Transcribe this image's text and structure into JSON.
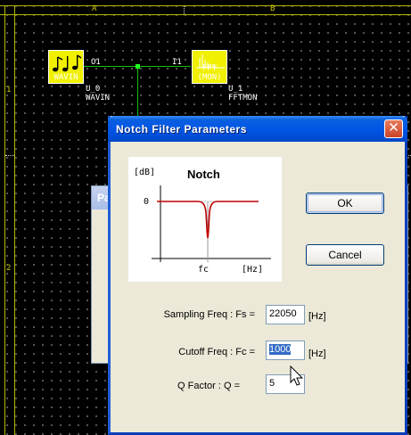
{
  "schematic": {
    "zones": {
      "col_a": "A",
      "col_b": "B",
      "row_1": "1",
      "row_2": "2"
    },
    "components": [
      {
        "icon": "music-notes-icon",
        "caption": "WAVIN",
        "port": "O1",
        "ref": "U_0",
        "type": "WAVIN"
      },
      {
        "icon": "spectrum-icon",
        "caption_line1": "FFT",
        "caption_line2": "(MON)",
        "port": "I1",
        "ref": "U_1",
        "type": "FFTMON"
      }
    ],
    "colors": {
      "grid_dot": "#6b6b6b",
      "frame": "#b8b800",
      "block": "#f0f000",
      "wire": "#10c010"
    }
  },
  "background_dialog": {
    "title_fragment": "Pa"
  },
  "dialog": {
    "title": "Notch Filter Parameters",
    "close_glyph": "✕",
    "graph": {
      "title": "Notch",
      "ylabel": "[dB]",
      "y_tick": "0",
      "x_tick": "fc",
      "xlabel": "[Hz]",
      "response_color": "#c00000"
    },
    "buttons": {
      "ok": "OK",
      "cancel": "Cancel"
    },
    "fields": {
      "fs": {
        "label": "Sampling Freq : Fs =",
        "value": "22050",
        "unit": "[Hz]"
      },
      "fc": {
        "label": "Cutoff Freq : Fc =",
        "value": "1000",
        "unit": "[Hz]"
      },
      "q": {
        "label": "Q Factor : Q =",
        "value": "5"
      }
    },
    "colors": {
      "titlebar": "#0055e5",
      "face": "#ece9d8",
      "selection": "#316ac5"
    }
  }
}
